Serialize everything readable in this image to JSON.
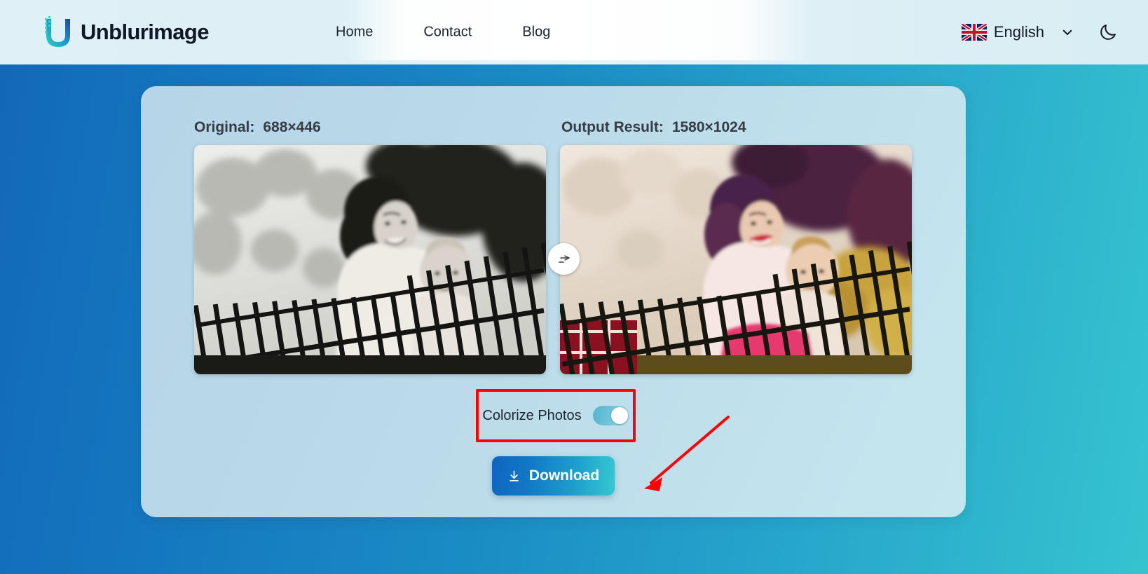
{
  "header": {
    "brand": {
      "name": "Unblurimage",
      "logo_icon": "u-logo-icon"
    },
    "nav": [
      {
        "label": "Home",
        "name": "nav-home"
      },
      {
        "label": "Contact",
        "name": "nav-contact"
      },
      {
        "label": "Blog",
        "name": "nav-blog"
      }
    ],
    "language": {
      "label": "English",
      "flag_icon": "uk-flag-icon",
      "chevron_icon": "chevron-down-icon"
    },
    "theme_toggle": {
      "icon": "moon-icon"
    }
  },
  "main": {
    "original": {
      "label": "Original:",
      "dimensions": "688×446"
    },
    "output": {
      "label": "Output Result:",
      "dimensions": "1580×1024"
    },
    "slider_handle_icon": "compare-arrows-icon",
    "colorize": {
      "label": "Colorize Photos",
      "state": "on",
      "highlight_color": "#ff0000"
    },
    "download": {
      "label": "Download",
      "icon": "download-icon"
    }
  },
  "colors": {
    "page_gradient_start": "#1368b8",
    "page_gradient_end": "#36c3cf",
    "card_bg": "#bcdcea",
    "header_bg": "#dff0f6",
    "accent": "#1d9ccb",
    "annotation_red": "#ff0000"
  }
}
